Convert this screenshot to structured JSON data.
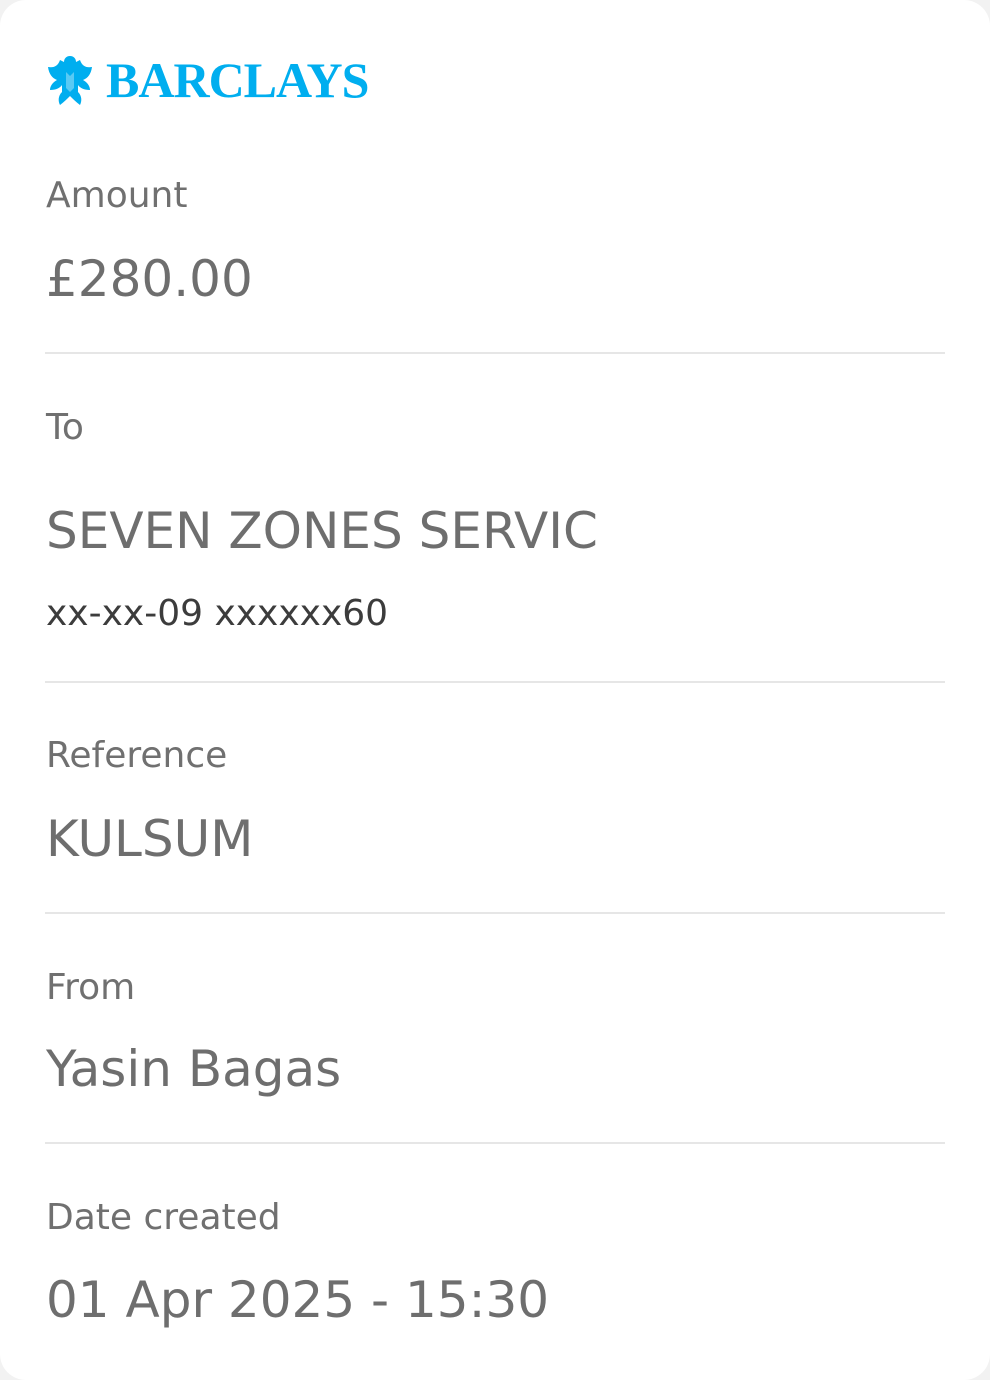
{
  "brand": {
    "name": "BARCLAYS",
    "color": "#00aeef",
    "icon": "barclays-eagle-icon"
  },
  "details": {
    "amount": {
      "label": "Amount",
      "value": "£280.00"
    },
    "to": {
      "label": "To",
      "name": "SEVEN ZONES SERVIC",
      "account": "xx-xx-09 xxxxxx60"
    },
    "reference": {
      "label": "Reference",
      "value": "KULSUM"
    },
    "from": {
      "label": "From",
      "value": "Yasin Bagas"
    },
    "date_created": {
      "label": "Date created",
      "value": "01 Apr 2025 - 15:30"
    }
  }
}
